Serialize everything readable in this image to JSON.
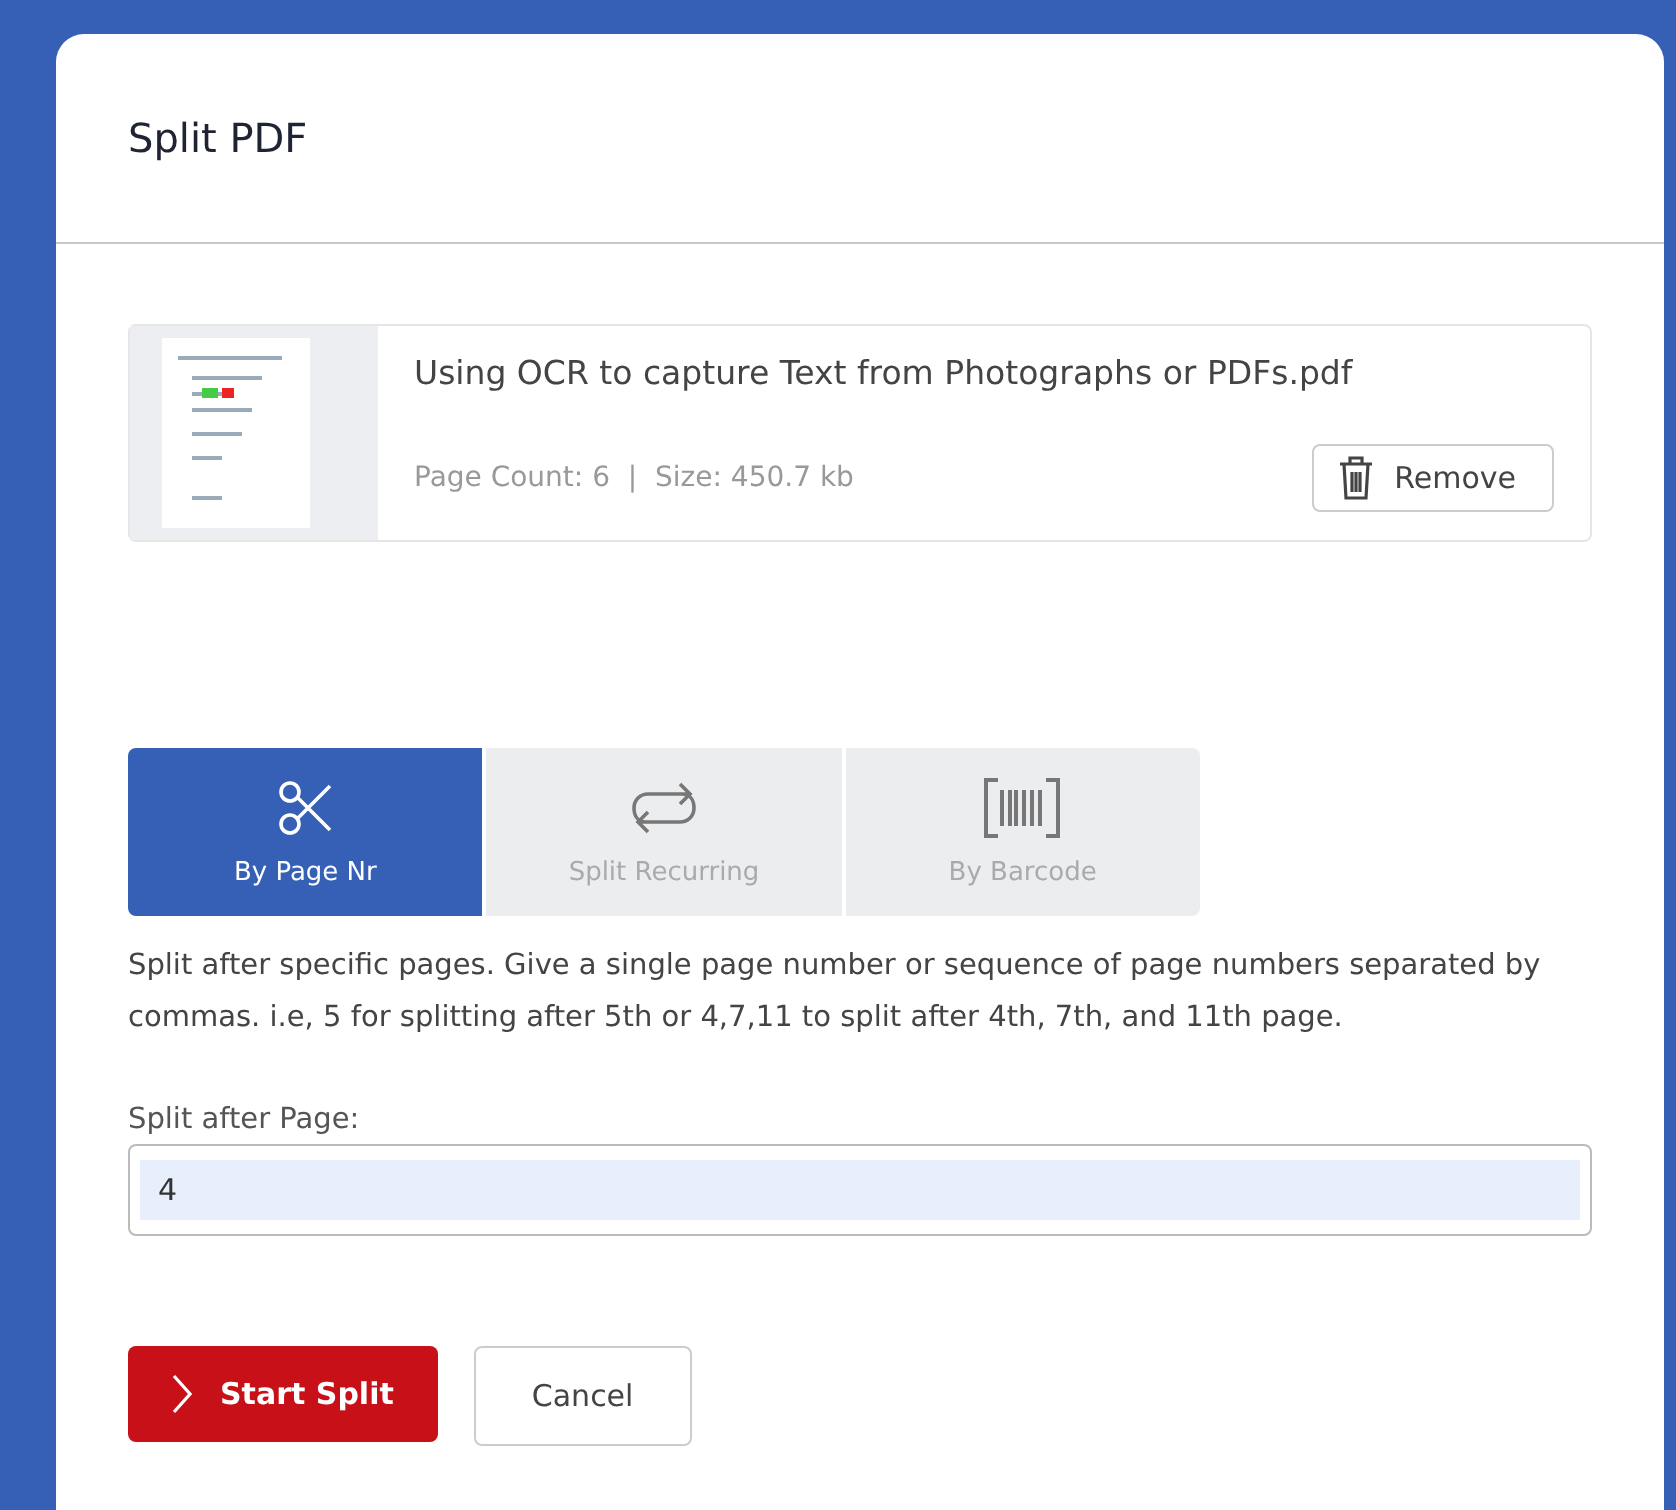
{
  "dialog": {
    "title": "Split PDF"
  },
  "file": {
    "name": "Using OCR to capture Text from Photographs or PDFs.pdf",
    "meta": "Page Count: 6  |  Size: 450.7 kb",
    "remove_button": "Remove"
  },
  "tabs": [
    {
      "kind": "scissors",
      "label": "By Page Nr",
      "selected": true
    },
    {
      "kind": "repeat",
      "label": "Split Recurring",
      "selected": false
    },
    {
      "kind": "barcode",
      "label": "By Barcode",
      "selected": false
    }
  ],
  "description": "Split after specific pages. Give a single page number or sequence of page numbers separated by commas. i.e, 5 for splitting after 5th or 4,7,11 to split after 4th, 7th, and 11th page.",
  "field": {
    "label": "Split after Page:",
    "value": "4"
  },
  "buttons": {
    "primary": "Start Split",
    "secondary": "Cancel"
  }
}
